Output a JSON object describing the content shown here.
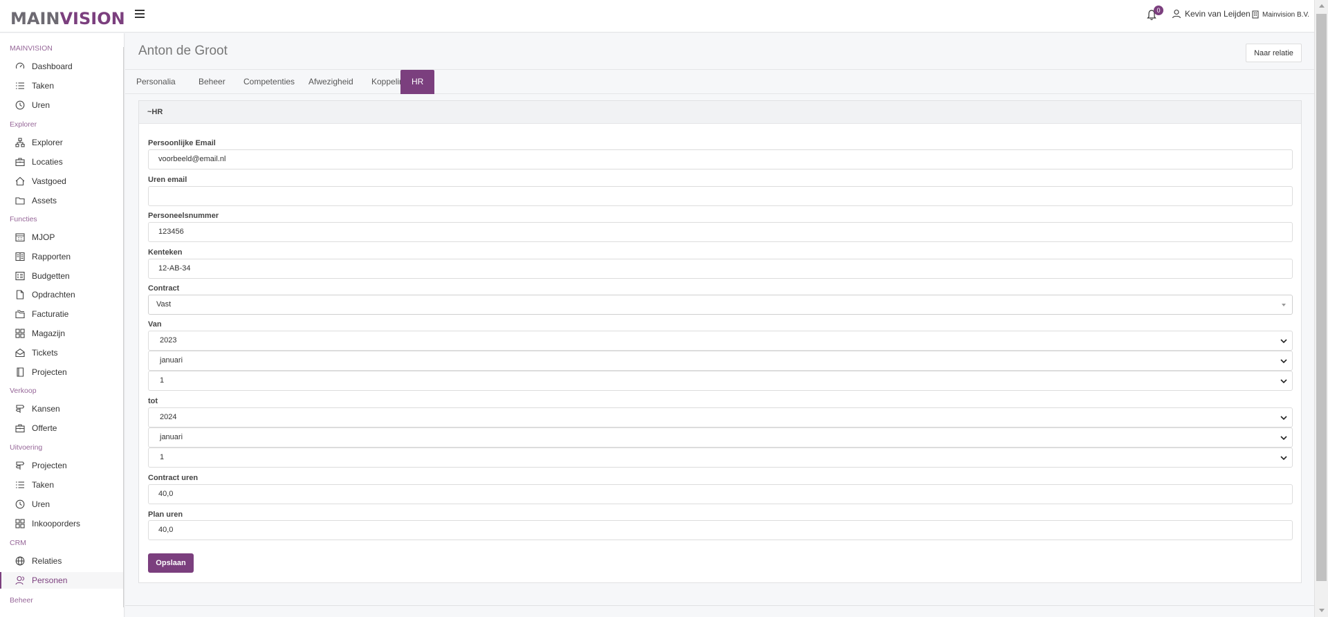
{
  "brand": {
    "logo_main": "MAIN",
    "logo_vision": "VISION"
  },
  "topbar": {
    "notifications_count": "0",
    "user_name": "Kevin van Leijden",
    "organization": "Mainvision B.V."
  },
  "sidebar": {
    "sections": [
      {
        "title": "MAINVISION",
        "items": [
          {
            "label": "Dashboard",
            "icon": "dashboard-icon"
          },
          {
            "label": "Taken",
            "icon": "list-icon"
          },
          {
            "label": "Uren",
            "icon": "clock-icon"
          }
        ]
      },
      {
        "title": "Explorer",
        "items": [
          {
            "label": "Explorer",
            "icon": "sitemap-icon"
          },
          {
            "label": "Locaties",
            "icon": "briefcase-icon"
          },
          {
            "label": "Vastgoed",
            "icon": "home-icon"
          },
          {
            "label": "Assets",
            "icon": "folder-icon"
          }
        ]
      },
      {
        "title": "Functies",
        "items": [
          {
            "label": "MJOP",
            "icon": "calendar-icon"
          },
          {
            "label": "Rapporten",
            "icon": "report-icon"
          },
          {
            "label": "Budgetten",
            "icon": "budget-icon"
          },
          {
            "label": "Opdrachten",
            "icon": "file-icon"
          },
          {
            "label": "Facturatie",
            "icon": "folders-icon"
          },
          {
            "label": "Magazijn",
            "icon": "grid-icon"
          },
          {
            "label": "Tickets",
            "icon": "inbox-icon"
          },
          {
            "label": "Projecten",
            "icon": "book-icon"
          }
        ]
      },
      {
        "title": "Verkoop",
        "items": [
          {
            "label": "Kansen",
            "icon": "signpost-icon"
          },
          {
            "label": "Offerte",
            "icon": "briefcase-icon"
          }
        ]
      },
      {
        "title": "Uitvoering",
        "items": [
          {
            "label": "Projecten",
            "icon": "signpost-icon"
          },
          {
            "label": "Taken",
            "icon": "list-icon"
          },
          {
            "label": "Uren",
            "icon": "clock-icon"
          },
          {
            "label": "Inkooporders",
            "icon": "grid-icon"
          }
        ]
      },
      {
        "title": "CRM",
        "items": [
          {
            "label": "Relaties",
            "icon": "globe-icon"
          },
          {
            "label": "Personen",
            "icon": "users-icon",
            "active": true
          }
        ]
      },
      {
        "title": "Beheer",
        "items": []
      }
    ]
  },
  "page": {
    "title": "Anton de Groot",
    "naar_relatie": "Naar relatie"
  },
  "tabs": [
    "Personalia",
    "Beheer",
    "Competenties",
    "Afwezigheid",
    "Koppeling",
    "HR"
  ],
  "active_tab": "HR",
  "card": {
    "title": "~HR",
    "fields": {
      "personal_email": {
        "label": "Persoonlijke Email",
        "value": "voorbeeld@email.nl"
      },
      "uren_email": {
        "label": "Uren email",
        "value": ""
      },
      "personeelsnummer": {
        "label": "Personeelsnummer",
        "value": "123456"
      },
      "kenteken": {
        "label": "Kenteken",
        "value": "12-AB-34"
      },
      "contract": {
        "label": "Contract",
        "value": "Vast"
      },
      "van": {
        "label": "Van",
        "year": "2023",
        "month": "januari",
        "day": "1"
      },
      "tot": {
        "label": "tot",
        "year": "2024",
        "month": "januari",
        "day": "1"
      },
      "contract_uren": {
        "label": "Contract uren",
        "value": "40,0"
      },
      "plan_uren": {
        "label": "Plan uren",
        "value": "40,0"
      }
    },
    "save_label": "Opslaan"
  },
  "colors": {
    "accent": "#7b3f7e",
    "sidebar_section": "#7b3f7e"
  }
}
